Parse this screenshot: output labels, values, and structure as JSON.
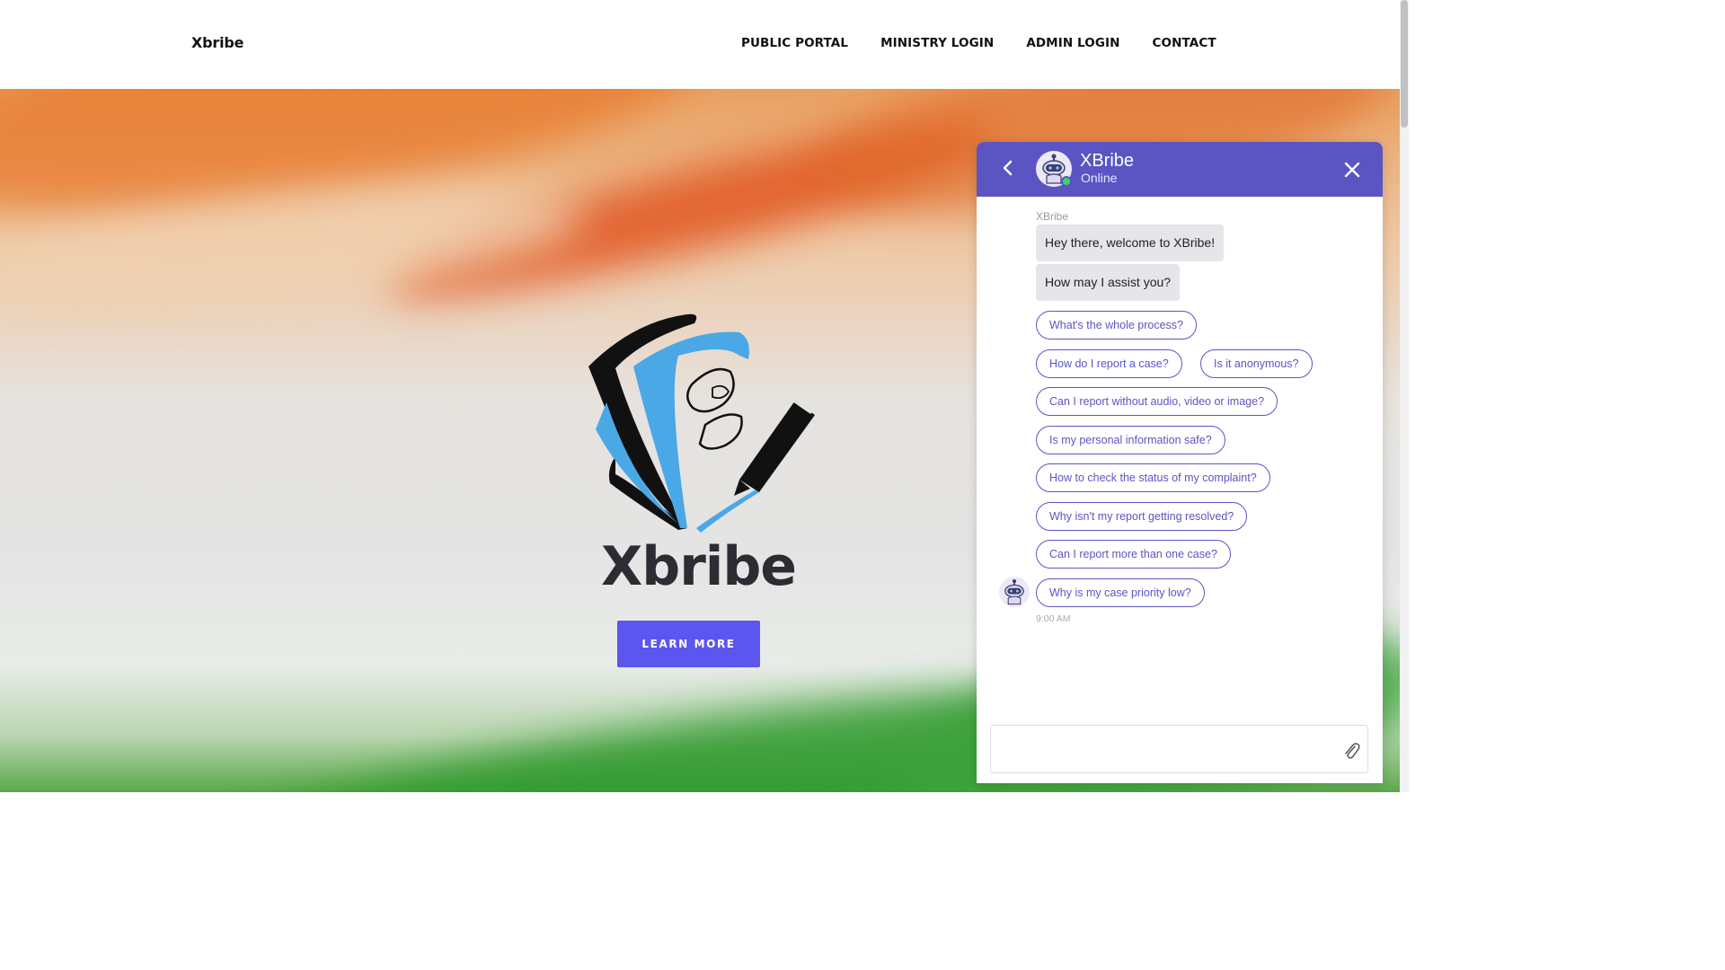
{
  "navbar": {
    "brand": "Xbribe",
    "links": [
      "PUBLIC PORTAL",
      "MINISTRY LOGIN",
      "ADMIN LOGIN",
      "CONTACT"
    ]
  },
  "hero": {
    "title": "Xbribe",
    "button_label": "LEARN MORE"
  },
  "chat": {
    "bot_name": "XBribe",
    "status": "Online",
    "sender_label": "XBribe",
    "messages": [
      "Hey there, welcome to XBribe!",
      "How may I assist you?"
    ],
    "quick_replies": [
      "What's the whole process?",
      "How do I report a case?",
      "Is it anonymous?",
      "Can I report without audio, video or image?",
      "Is my personal information safe?",
      "How to check the status of my complaint?",
      "Why isn't my report getting resolved?",
      "Can I report more than one case?",
      "Why is my case priority low?"
    ],
    "timestamp": "9:00 AM",
    "input_value": ""
  },
  "colors": {
    "accent": "#5b55c3",
    "button": "#5c55ee",
    "online": "#3dd36a",
    "saffron": "#e2561a",
    "green": "#3a9a34"
  },
  "icons": {
    "back": "chevron-left-icon",
    "close": "close-icon",
    "attach": "paperclip-icon",
    "avatar": "robot-icon"
  }
}
